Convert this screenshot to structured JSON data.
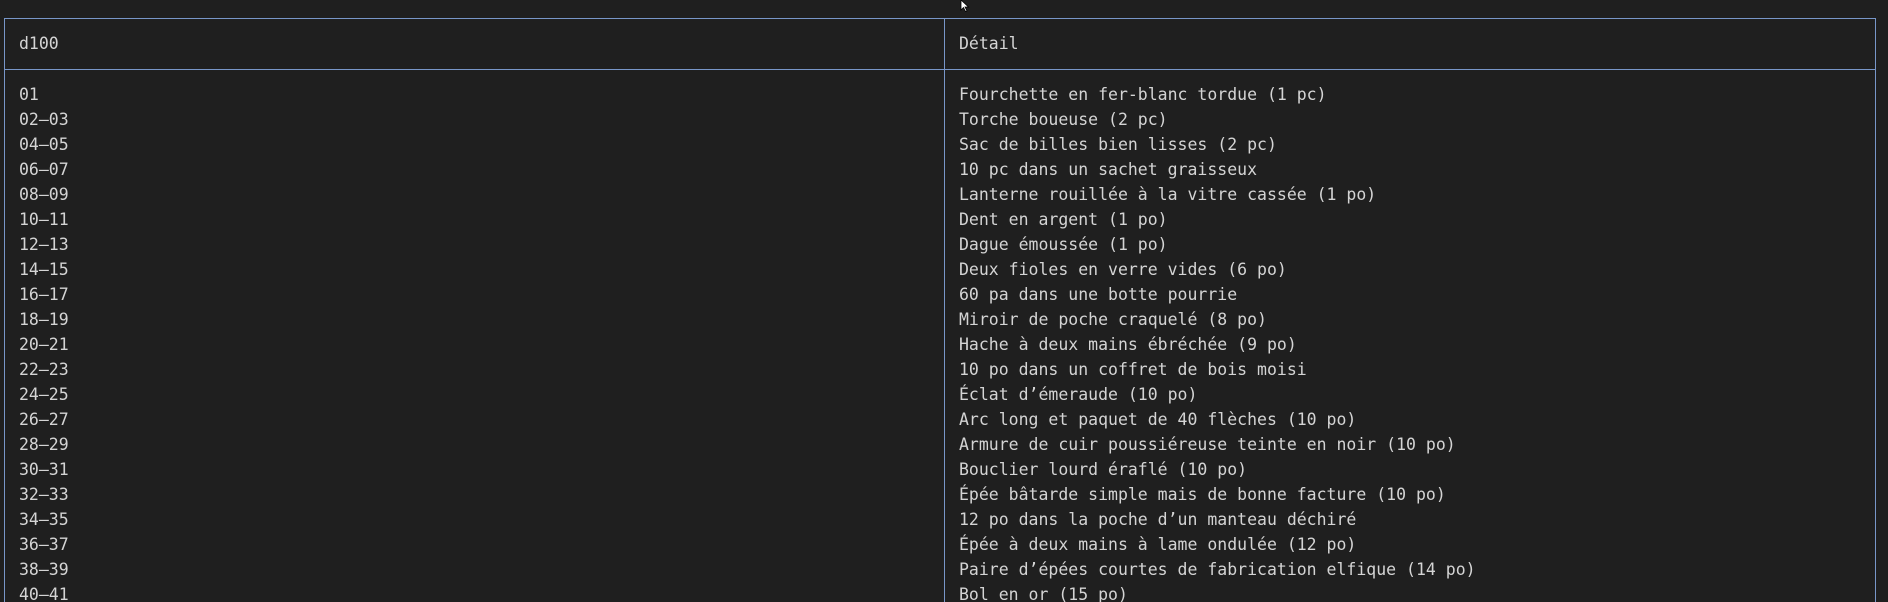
{
  "table": {
    "headers": {
      "roll": "d100",
      "detail": "Détail"
    },
    "rows": [
      {
        "roll": "01",
        "detail": "Fourchette en fer-blanc tordue (1 pc)"
      },
      {
        "roll": "02–03",
        "detail": "Torche boueuse (2 pc)"
      },
      {
        "roll": "04–05",
        "detail": "Sac de billes bien lisses (2 pc)"
      },
      {
        "roll": "06–07",
        "detail": "10 pc dans un sachet graisseux"
      },
      {
        "roll": "08–09",
        "detail": "Lanterne rouillée à la vitre cassée (1 po)"
      },
      {
        "roll": "10–11",
        "detail": "Dent en argent (1 po)"
      },
      {
        "roll": "12–13",
        "detail": "Dague émoussée (1 po)"
      },
      {
        "roll": "14–15",
        "detail": "Deux fioles en verre vides (6 po)"
      },
      {
        "roll": "16–17",
        "detail": "60 pa dans une botte pourrie"
      },
      {
        "roll": "18–19",
        "detail": "Miroir de poche craquelé (8 po)"
      },
      {
        "roll": "20–21",
        "detail": "Hache à deux mains ébréchée (9 po)"
      },
      {
        "roll": "22–23",
        "detail": "10 po dans un coffret de bois moisi"
      },
      {
        "roll": "24–25",
        "detail": "Éclat d’émeraude (10 po)"
      },
      {
        "roll": "26–27",
        "detail": "Arc long et paquet de 40 flèches (10 po)"
      },
      {
        "roll": "28–29",
        "detail": "Armure de cuir poussiéreuse teinte en noir (10 po)"
      },
      {
        "roll": "30–31",
        "detail": "Bouclier lourd éraflé (10 po)"
      },
      {
        "roll": "32–33",
        "detail": "Épée bâtarde simple mais de bonne facture (10 po)"
      },
      {
        "roll": "34–35",
        "detail": "12 po dans la poche d’un manteau déchiré"
      },
      {
        "roll": "36–37",
        "detail": "Épée à deux mains à lame ondulée (12 po)"
      },
      {
        "roll": "38–39",
        "detail": "Paire d’épées courtes de fabrication elfique (14 po)"
      },
      {
        "roll": "40–41",
        "detail": "Bol en or (15 po)"
      }
    ]
  },
  "colors": {
    "background": "#1f1f1f",
    "border": "#7896c8",
    "text": "#d4d4d4"
  },
  "icons": {
    "pointer": "mouse-cursor-icon"
  }
}
